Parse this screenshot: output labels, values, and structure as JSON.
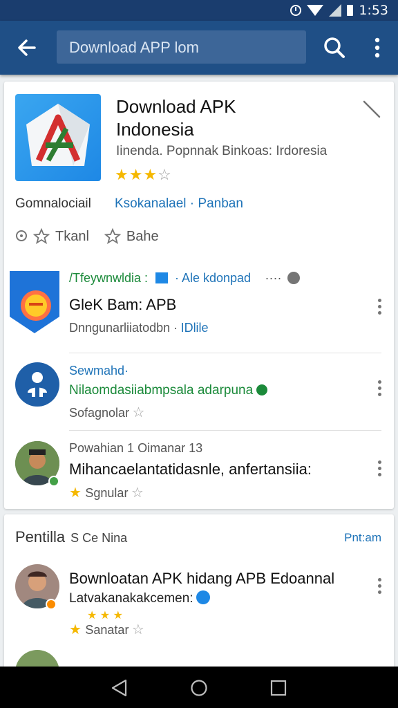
{
  "status": {
    "time": "1:53"
  },
  "appbar": {
    "search_text": "Download APP lom"
  },
  "app": {
    "title_line1": "Download APK",
    "title_line2": "Indonesia",
    "subtitle": "Iinenda. Popnnak Binkoas: Irdoresia",
    "rating": 3,
    "meta_left": "Gomnalociail",
    "meta_link": "Ksokanalael · Panban",
    "action1": "Tkanl",
    "action2": "Bahe"
  },
  "list": [
    {
      "line1": "/Tfeywnwldia :",
      "line1_tag": "· Ale kdonpad",
      "line1_more": "····",
      "title": "GleK Bam: APB",
      "line3": "Dnngunarliiatodbn ·",
      "line3_link": "IDlile"
    },
    {
      "line1": "Sewmahd·",
      "line2": "Nilaomdasiiabmpsala adarpuna",
      "line3": "Sofagnolar"
    },
    {
      "line1": "Powahian 1 Oimanar 13",
      "title": "Mihancaelantatidasnle, anfertansiia:",
      "line3": "Sgnular"
    }
  ],
  "section": {
    "title": "Pentilla",
    "sub": "S Ce Nina",
    "link": "Pnt:am",
    "item": {
      "title": "Bownloatan APK hidang APB Edoannal",
      "line2": "Latvakanakakcemen:",
      "line3": "Sanatar"
    }
  },
  "colors": {
    "appbar": "#1f4f86",
    "statusbar": "#1a3d6e",
    "link": "#1e73b8",
    "star": "#f5b800",
    "green": "#1b8a3a"
  }
}
